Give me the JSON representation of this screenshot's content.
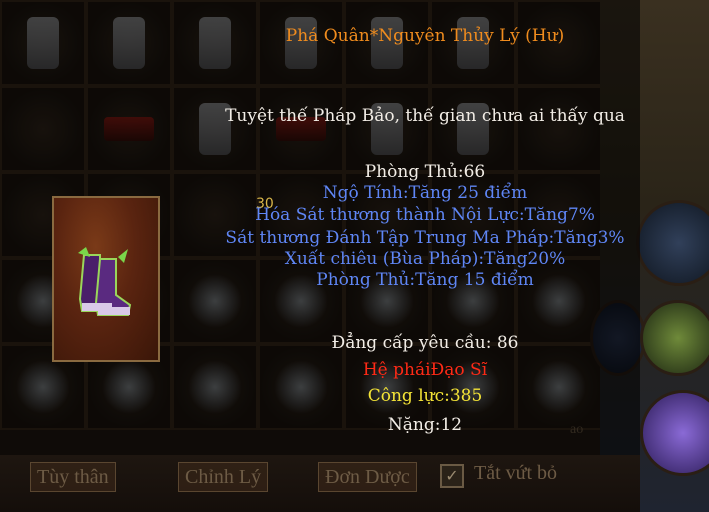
{
  "tooltip": {
    "title": "Phá Quân*Nguyên Thủy Lý (Hư)",
    "description": "Tuyệt thế Pháp Bảo, thế gian chưa ai thấy qua",
    "base_stat": "Phòng Thủ:66",
    "attributes": [
      "Ngộ Tính:Tăng 25 điểm",
      "Hóa Sát thương thành Nội Lực:Tăng7%",
      "Sát thương Đánh Tập Trung Ma Pháp:Tăng3%",
      "Xuất chiêu (Bùa Pháp):Tăng20%",
      "Phòng Thủ:Tăng 15 điểm"
    ],
    "level_req": "Đẳng cấp yêu cầu: 86",
    "faction": "Hệ pháiĐạo Sĩ",
    "power": "Công lực:385",
    "weight": "Nặng:12"
  },
  "inventory": {
    "slot_level_badge": "30",
    "buttons": {
      "tuy_than": "Tùy thân",
      "chinh_ly": "Chỉnh Lý",
      "don_duoc": "Đơn Dược",
      "tat_vut_bo": "Tắt vứt bỏ"
    },
    "side_text": "ao"
  },
  "colors": {
    "title": "#f08c1e",
    "attribute": "#5f86f5",
    "faction": "#ff2a16",
    "power": "#f4e436"
  }
}
